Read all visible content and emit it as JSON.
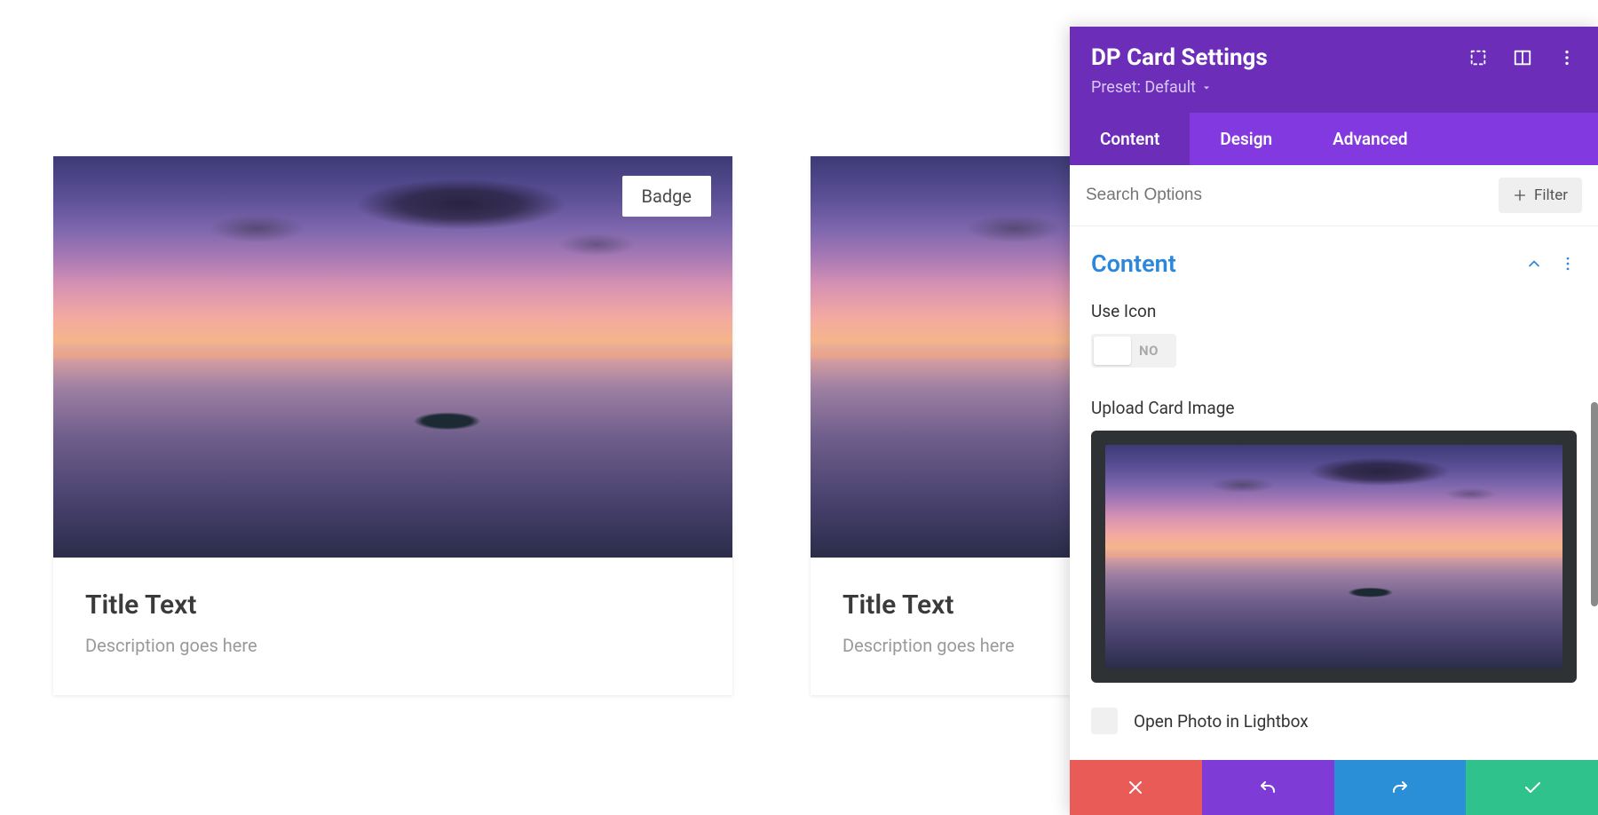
{
  "card": {
    "badge": "Badge",
    "title": "Title Text",
    "description": "Description goes here"
  },
  "panel": {
    "title": "DP Card Settings",
    "preset_label": "Preset: Default",
    "tabs": {
      "content": "Content",
      "design": "Design",
      "advanced": "Advanced"
    },
    "search_placeholder": "Search Options",
    "filter_label": "Filter",
    "section_heading": "Content",
    "use_icon_label": "Use Icon",
    "toggle_value": "NO",
    "upload_label": "Upload Card Image",
    "lightbox_label": "Open Photo in Lightbox"
  }
}
